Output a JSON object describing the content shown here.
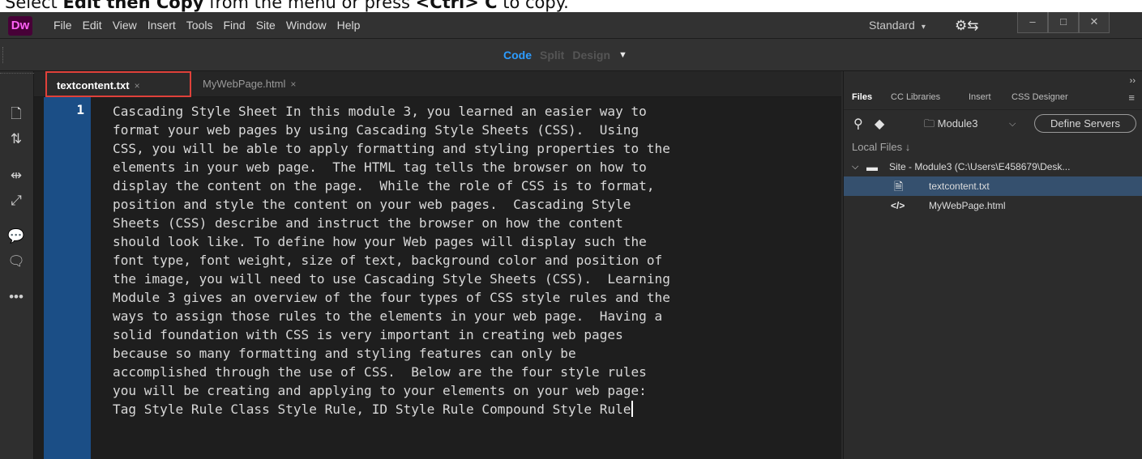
{
  "caption": {
    "text_pre": "Select ",
    "text_bold": "Edit then Copy",
    "text_mid": " from the menu or press ",
    "text_bold2": "<Ctrl> C",
    "text_post": " to copy."
  },
  "app": {
    "logo": "Dw",
    "menu": [
      "File",
      "Edit",
      "View",
      "Insert",
      "Tools",
      "Find",
      "Site",
      "Window",
      "Help"
    ],
    "workspace": "Standard",
    "window_buttons": [
      "–",
      "□",
      "✕"
    ]
  },
  "view_switch": {
    "code": "Code",
    "split": "Split",
    "design": "Design"
  },
  "tabs": {
    "active": "textcontent.txt",
    "inactive": "MyWebPage.html",
    "close": "×"
  },
  "editor": {
    "line_number": "1",
    "lines": [
      "Cascading Style Sheet In this module 3, you learned an easier way to",
      "format your web pages by using Cascading Style Sheets (CSS).  Using",
      "CSS, you will be able to apply formatting and styling properties to the",
      "elements in your web page.  The HTML tag tells the browser on how to",
      "display the content on the page.  While the role of CSS is to format,",
      "position and style the content on your web pages.  Cascading Style",
      "Sheets (CSS) describe and instruct the browser on how the content",
      "should look like. To define how your Web pages will display such the",
      "font type, font weight, size of text, background color and position of",
      "the image, you will need to use Cascading Style Sheets (CSS).  Learning",
      "Module 3 gives an overview of the four types of CSS style rules and the",
      "ways to assign those rules to the elements in your web page.  Having a",
      "solid foundation with CSS is very important in creating web pages",
      "because so many formatting and styling features can only be",
      "accomplished through the use of CSS.  Below are the four style rules",
      "you will be creating and applying to your elements on your web page:",
      "Tag Style Rule Class Style Rule, ID Style Rule Compound Style Rule"
    ]
  },
  "panel": {
    "tabs": [
      "Files",
      "CC Libraries",
      "Insert",
      "CSS Designer"
    ],
    "site": "Module3",
    "define_servers": "Define Servers",
    "local_files": "Local Files",
    "site_root": "Site - Module3 (C:\\Users\\E458679\\Desk...",
    "files": [
      "textcontent.txt",
      "MyWebPage.html"
    ]
  }
}
